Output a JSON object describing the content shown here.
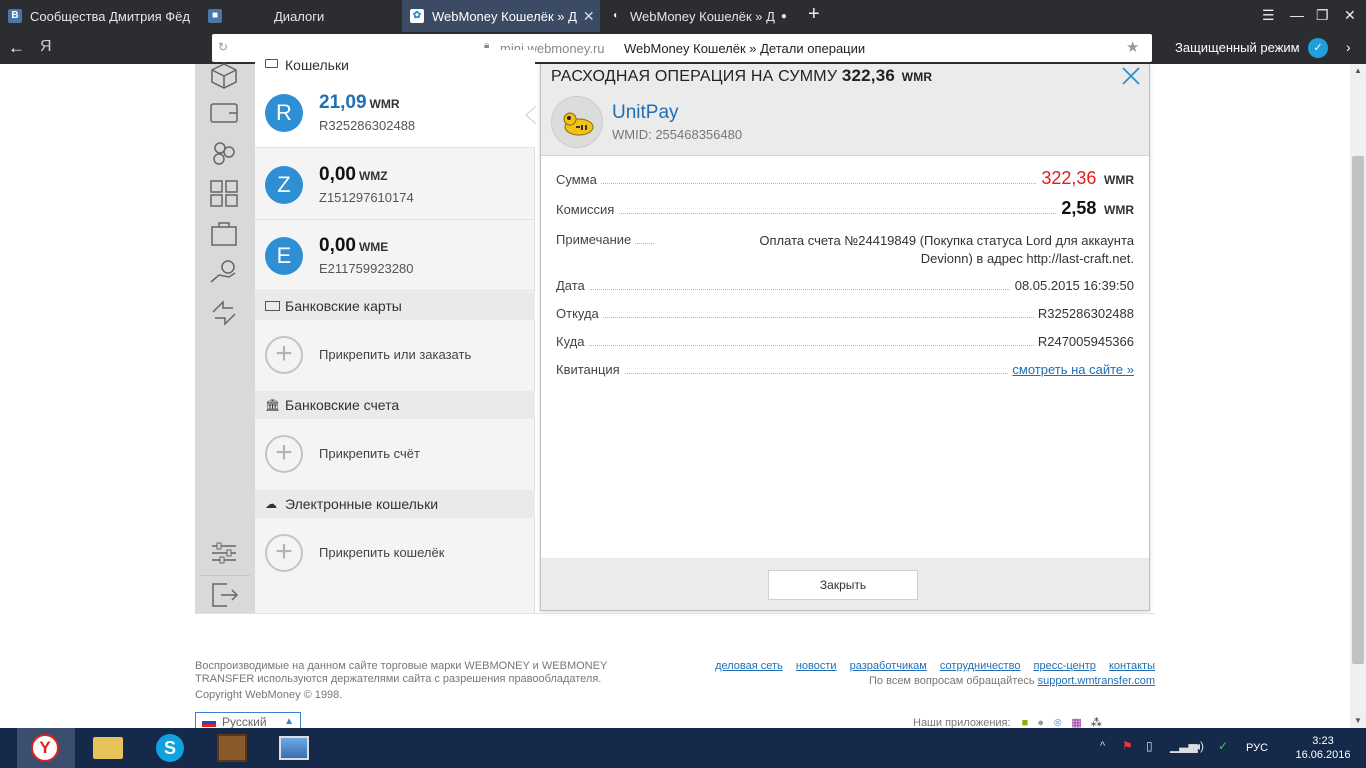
{
  "browser": {
    "tabs": [
      {
        "label": "Сообщества Дмитрия Фёд",
        "icon": "vk-icon"
      },
      {
        "label": "Диалоги",
        "icon": "chat-icon"
      },
      {
        "label": "WebMoney Кошелёк » Д",
        "icon": "webmoney-icon",
        "active": true
      },
      {
        "label": "WebMoney Кошелёк » Д",
        "icon": "webmoney-icon"
      }
    ],
    "new_tab": "+",
    "address_host": "mini.webmoney.ru",
    "address_title": "WebMoney Кошелёк » Детали операции",
    "secure_mode": "Защищенный режим",
    "yandex": "Я"
  },
  "wallets": {
    "header": "Кошельки",
    "items": [
      {
        "letter": "R",
        "amount": "21,09",
        "currency": "WMR",
        "number": "R325286302488",
        "amount_color": "#1f6fb5"
      },
      {
        "letter": "Z",
        "amount": "0,00",
        "currency": "WMZ",
        "number": "Z151297610174",
        "amount_color": "#111111"
      },
      {
        "letter": "E",
        "amount": "0,00",
        "currency": "WME",
        "number": "E211759923280",
        "amount_color": "#111111"
      }
    ],
    "sections": [
      {
        "title": "Банковские карты",
        "action": "Прикрепить или заказать"
      },
      {
        "title": "Банковские счета",
        "action": "Прикрепить счёт"
      },
      {
        "title": "Электронные кошельки",
        "action": "Прикрепить кошелёк"
      }
    ]
  },
  "operation": {
    "title_prefix": "РАСХОДНАЯ ОПЕРАЦИЯ НА СУММУ",
    "title_amount": "322,36",
    "title_currency": "WMR",
    "counterparty": "UnitPay",
    "wmid": "WMID: 255468356480",
    "rows": {
      "sum_label": "Сумма",
      "sum_value": "322,36",
      "sum_currency": "WMR",
      "fee_label": "Комиссия",
      "fee_value": "2,58",
      "fee_currency": "WMR",
      "note_label": "Примечание",
      "note_line1": "Оплата счета №24419849 (Покупка статуса Lord для аккаунта",
      "note_line2": "Devionn) в адрес http://last-craft.net.",
      "date_label": "Дата",
      "date_value": "08.05.2015 16:39:50",
      "from_label": "Откуда",
      "from_value": "R325286302488",
      "to_label": "Куда",
      "to_value": "R247005945366",
      "receipt_label": "Квитанция",
      "receipt_link": "смотреть на сайте »"
    },
    "close_button": "Закрыть",
    "accent_red": "#e01e1e"
  },
  "footer": {
    "legal_line1": "Воспроизводимые на данном сайте торговые марки WEBMONEY и WEBMONEY",
    "legal_line2": "TRANSFER используются держателями сайта с разрешения правообладателя.",
    "copyright": "Copyright WebMoney © 1998.",
    "links": [
      "деловая сеть",
      "новости",
      "разработчикам",
      "сотрудничество",
      "пресс-центр",
      "контакты"
    ],
    "support_prefix": "По всем вопросам обращайтесь",
    "support_link": "support.wmtransfer.com",
    "language": "Русский",
    "apps_label": "Наши приложения:"
  },
  "taskbar": {
    "lang": "РУС",
    "time": "3:23",
    "date": "16.06.2016"
  }
}
